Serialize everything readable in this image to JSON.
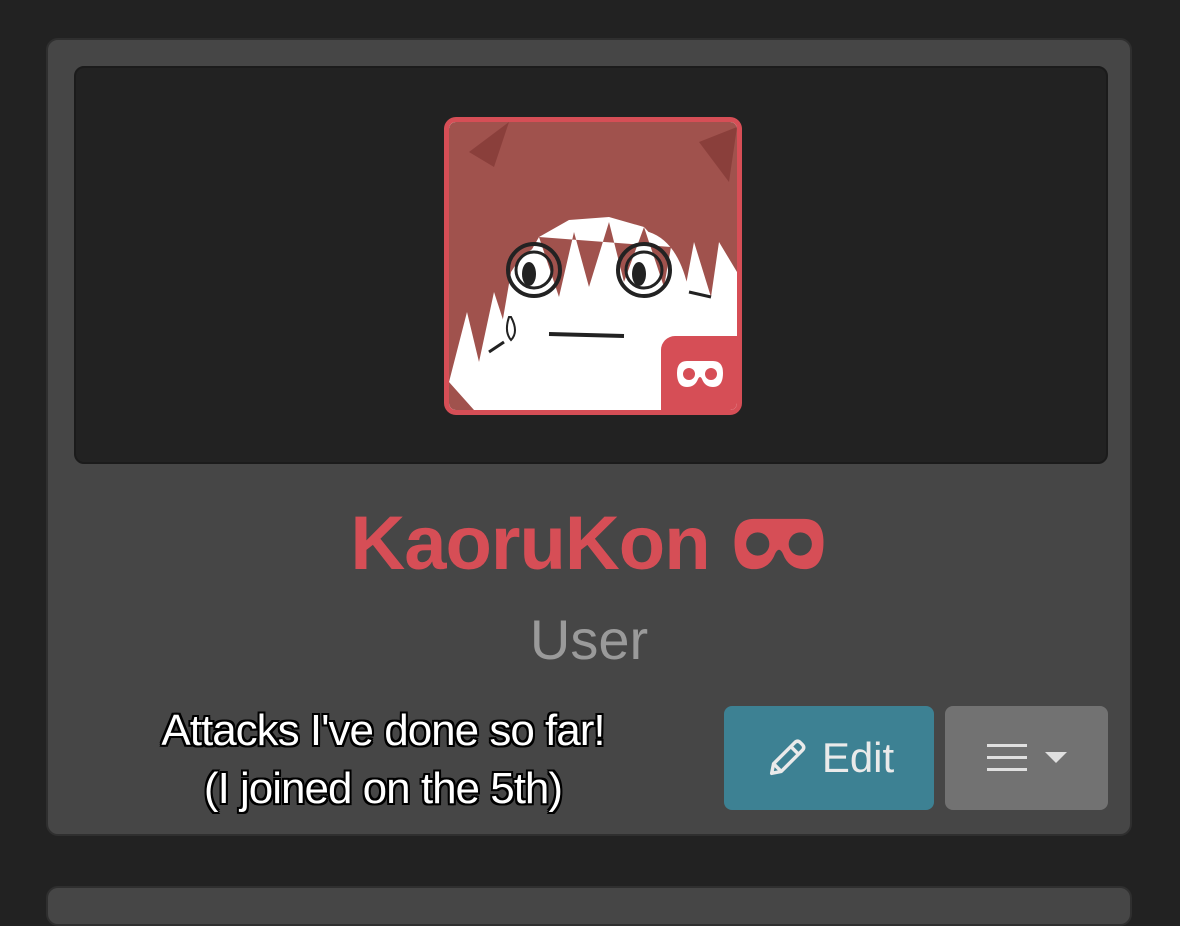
{
  "profile": {
    "username": "KaoruKon",
    "role": "User",
    "name_color": "#d64e56",
    "badge_icon": "mask-icon"
  },
  "caption": {
    "line1": "Attacks I've done so far!",
    "line2": "(I joined on the 5th)"
  },
  "actions": {
    "edit_label": "Edit",
    "edit_icon": "pencil-icon",
    "menu_icon": "hamburger-icon"
  },
  "colors": {
    "accent": "#d64e56",
    "edit_button": "#3d8193",
    "menu_button": "#727272",
    "card": "#464646",
    "background": "#222222"
  }
}
